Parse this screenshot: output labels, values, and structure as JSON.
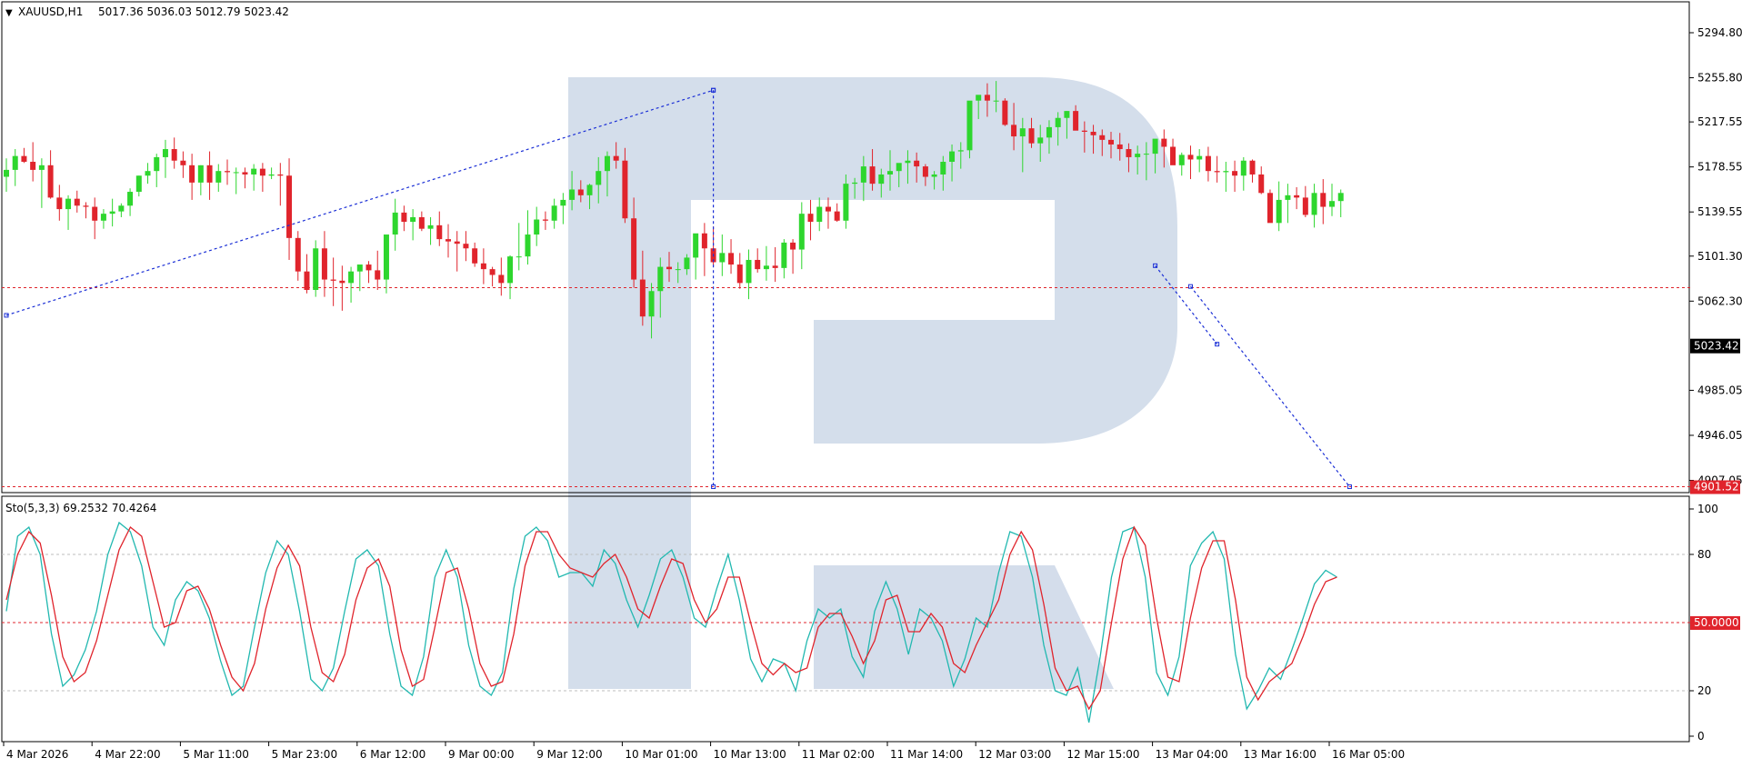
{
  "chart_data": {
    "type": "candlestick",
    "symbol_header": "XAUUSD,H1",
    "ohlc_header": "5017.36 5036.03 5012.79 5023.42",
    "price_axis": {
      "range": [
        4898.0,
        5320.0
      ],
      "ticks": [
        "5294.80",
        "5255.80",
        "5217.55",
        "5178.55",
        "5139.55",
        "5101.30",
        "5062.30",
        "5023.42",
        "4985.05",
        "4946.05",
        "4907.05"
      ],
      "tick_values": [
        5294.8,
        5255.8,
        5217.55,
        5178.55,
        5139.55,
        5101.3,
        5062.3,
        5023.42,
        4985.05,
        4946.05,
        4907.05
      ]
    },
    "current_price": {
      "label": "5023.42",
      "value": 5023.42,
      "color": "#000000"
    },
    "level_lines": [
      {
        "value": 5074.0,
        "color": "#e0242c"
      },
      {
        "value": 4901.52,
        "label": "4901.52",
        "color": "#e0242c"
      }
    ],
    "forecast_lines": [
      {
        "points": [
          [
            0,
            5050
          ],
          [
            80,
            5245
          ]
        ],
        "color": "#1b2fd6"
      },
      {
        "points": [
          [
            80,
            5245
          ],
          [
            80,
            4901.52
          ]
        ],
        "color": "#1b2fd6"
      },
      {
        "points": [
          [
            134,
            5075
          ],
          [
            152,
            4901.52
          ]
        ],
        "color": "#1b2fd6"
      },
      {
        "points": [
          [
            130,
            5093
          ],
          [
            137,
            5025
          ]
        ],
        "color": "#1b2fd6"
      }
    ],
    "candle_count": 152,
    "candles": {
      "o": [
        5170,
        5176,
        5188,
        5183,
        5176,
        5180,
        5152,
        5142,
        5151,
        5145,
        5144,
        5132,
        5138,
        5140,
        5145,
        5157,
        5171,
        5175,
        5187,
        5194,
        5184,
        5180,
        5165,
        5180,
        5165,
        5175,
        5174,
        5174,
        5172,
        5177,
        5171,
        5172,
        5171,
        5117,
        5088,
        5072,
        5108,
        5081,
        5080,
        5078,
        5088,
        5094,
        5089,
        5081,
        5120,
        5139,
        5131,
        5135,
        5125,
        5128,
        5116,
        5114,
        5112,
        5108,
        5095,
        5090,
        5085,
        5078,
        5101,
        5101,
        5120,
        5133,
        5132,
        5145,
        5150,
        5159,
        5154,
        5163,
        5175,
        5188,
        5184,
        5134,
        5081,
        5049,
        5071,
        5092,
        5090,
        5090,
        5100,
        5121,
        5108,
        5096,
        5104,
        5094,
        5078,
        5098,
        5090,
        5093,
        5091,
        5113,
        5107,
        5138,
        5131,
        5144,
        5140,
        5132,
        5164,
        5165,
        5179,
        5164,
        5172,
        5175,
        5182,
        5184,
        5179,
        5170,
        5172,
        5183,
        5192,
        5193,
        5236,
        5241,
        5236,
        5236,
        5215,
        5205,
        5212,
        5199,
        5204,
        5213,
        5221,
        5227,
        5210,
        5209,
        5206,
        5202,
        5198,
        5194,
        5187,
        5190,
        5190,
        5203,
        5196,
        5180,
        5189,
        5185,
        5188,
        5175,
        5174,
        5175,
        5171,
        5184,
        5172,
        5156,
        5130,
        5150,
        5154,
        5152,
        5137,
        5156,
        5144,
        5149
      ],
      "h": [
        5186,
        5194,
        5195,
        5200,
        5186,
        5193,
        5163,
        5154,
        5158,
        5148,
        5152,
        5142,
        5151,
        5147,
        5160,
        5171,
        5182,
        5190,
        5202,
        5204,
        5192,
        5190,
        5180,
        5192,
        5181,
        5185,
        5178,
        5178,
        5181,
        5182,
        5178,
        5182,
        5186,
        5123,
        5103,
        5115,
        5123,
        5100,
        5093,
        5092,
        5091,
        5097,
        5106,
        5117,
        5151,
        5145,
        5142,
        5140,
        5135,
        5140,
        5129,
        5123,
        5123,
        5113,
        5108,
        5092,
        5100,
        5102,
        5130,
        5141,
        5144,
        5140,
        5151,
        5156,
        5175,
        5167,
        5164,
        5187,
        5192,
        5200,
        5195,
        5152,
        5106,
        5078,
        5100,
        5105,
        5096,
        5103,
        5102,
        5130,
        5127,
        5120,
        5116,
        5104,
        5107,
        5108,
        5110,
        5109,
        5116,
        5116,
        5148,
        5150,
        5152,
        5152,
        5147,
        5172,
        5169,
        5188,
        5194,
        5177,
        5193,
        5178,
        5193,
        5191,
        5181,
        5175,
        5188,
        5198,
        5200,
        5214,
        5240,
        5251,
        5253,
        5238,
        5234,
        5221,
        5221,
        5215,
        5219,
        5226,
        5227,
        5232,
        5218,
        5215,
        5211,
        5209,
        5208,
        5199,
        5197,
        5200,
        5198,
        5211,
        5203,
        5191,
        5197,
        5194,
        5196,
        5188,
        5183,
        5184,
        5187,
        5185,
        5179,
        5159,
        5166,
        5164,
        5161,
        5162,
        5164,
        5168,
        5164,
        5159
      ],
      "l": [
        5157,
        5162,
        5182,
        5166,
        5143,
        5151,
        5132,
        5124,
        5139,
        5134,
        5116,
        5125,
        5127,
        5135,
        5136,
        5153,
        5164,
        5161,
        5169,
        5177,
        5169,
        5150,
        5154,
        5150,
        5157,
        5163,
        5155,
        5160,
        5158,
        5157,
        5168,
        5145,
        5098,
        5080,
        5069,
        5066,
        5066,
        5058,
        5054,
        5061,
        5071,
        5078,
        5072,
        5069,
        5106,
        5123,
        5115,
        5123,
        5111,
        5110,
        5100,
        5088,
        5097,
        5092,
        5077,
        5075,
        5067,
        5064,
        5089,
        5094,
        5110,
        5124,
        5125,
        5129,
        5141,
        5148,
        5142,
        5147,
        5153,
        5177,
        5130,
        5074,
        5041,
        5030,
        5048,
        5079,
        5078,
        5085,
        5081,
        5084,
        5093,
        5084,
        5086,
        5073,
        5064,
        5087,
        5080,
        5079,
        5082,
        5086,
        5090,
        5115,
        5123,
        5125,
        5131,
        5125,
        5151,
        5149,
        5158,
        5152,
        5158,
        5161,
        5164,
        5165,
        5162,
        5159,
        5158,
        5166,
        5177,
        5186,
        5220,
        5222,
        5226,
        5214,
        5193,
        5174,
        5195,
        5183,
        5190,
        5197,
        5203,
        5213,
        5191,
        5190,
        5188,
        5186,
        5184,
        5174,
        5172,
        5167,
        5173,
        5178,
        5183,
        5171,
        5168,
        5174,
        5166,
        5165,
        5157,
        5157,
        5158,
        5165,
        5155,
        5139,
        5123,
        5130,
        5142,
        5135,
        5126,
        5129,
        5136,
        5135
      ],
      "c": [
        5176,
        5188,
        5183,
        5176,
        5180,
        5152,
        5142,
        5151,
        5145,
        5144,
        5132,
        5138,
        5140,
        5145,
        5157,
        5171,
        5175,
        5187,
        5194,
        5184,
        5180,
        5165,
        5180,
        5165,
        5175,
        5174,
        5174,
        5172,
        5177,
        5171,
        5172,
        5171,
        5117,
        5088,
        5072,
        5108,
        5081,
        5080,
        5078,
        5088,
        5094,
        5089,
        5081,
        5120,
        5139,
        5131,
        5135,
        5125,
        5128,
        5116,
        5114,
        5112,
        5108,
        5095,
        5090,
        5085,
        5078,
        5101,
        5101,
        5120,
        5133,
        5132,
        5145,
        5150,
        5159,
        5154,
        5163,
        5175,
        5188,
        5184,
        5134,
        5081,
        5049,
        5071,
        5092,
        5090,
        5090,
        5100,
        5121,
        5108,
        5096,
        5104,
        5094,
        5078,
        5098,
        5090,
        5093,
        5091,
        5113,
        5107,
        5138,
        5131,
        5144,
        5140,
        5132,
        5164,
        5165,
        5179,
        5164,
        5172,
        5175,
        5182,
        5184,
        5179,
        5170,
        5172,
        5183,
        5192,
        5193,
        5236,
        5241,
        5236,
        5236,
        5215,
        5205,
        5212,
        5199,
        5204,
        5213,
        5221,
        5227,
        5210,
        5209,
        5206,
        5202,
        5198,
        5194,
        5187,
        5190,
        5190,
        5203,
        5196,
        5180,
        5189,
        5185,
        5188,
        5175,
        5174,
        5175,
        5171,
        5184,
        5172,
        5156,
        5130,
        5150,
        5154,
        5152,
        5137,
        5156,
        5144,
        5149,
        5156
      ]
    },
    "oscillator": {
      "header": "Sto(5,3,3) 69.2532 70.4264",
      "range": [
        0,
        100
      ],
      "ticks": [
        "100",
        "80",
        "20",
        "0"
      ],
      "tick_values": [
        100,
        80,
        20,
        0
      ],
      "level_lines": [
        {
          "value": 80,
          "color": "#bdbdbd"
        },
        {
          "value": 50,
          "label": "50.0000",
          "color": "#e0242c"
        },
        {
          "value": 20,
          "color": "#bdbdbd"
        }
      ],
      "series": [
        {
          "color": "#21b8b0",
          "values": [
            55,
            88,
            92,
            80,
            45,
            22,
            27,
            38,
            55,
            80,
            94,
            90,
            75,
            48,
            40,
            60,
            68,
            64,
            52,
            33,
            18,
            22,
            48,
            72,
            86,
            80,
            55,
            25,
            20,
            30,
            55,
            78,
            82,
            75,
            45,
            22,
            18,
            35,
            70,
            82,
            70,
            40,
            22,
            18,
            28,
            65,
            88,
            92,
            86,
            70,
            72,
            72,
            66,
            82,
            76,
            60,
            48,
            62,
            78,
            82,
            70,
            52,
            48,
            65,
            80,
            60,
            34,
            24,
            34,
            32,
            20,
            42,
            56,
            52,
            56,
            35,
            26,
            55,
            68,
            56,
            36,
            56,
            52,
            42,
            22,
            34,
            52,
            48,
            72,
            90,
            88,
            70,
            40,
            20,
            18,
            30,
            6,
            35,
            70,
            90,
            92,
            70,
            28,
            18,
            35,
            75,
            85,
            90,
            78,
            36,
            12,
            20,
            30,
            25,
            38,
            52,
            67,
            73,
            70
          ],
          "x_start": 0,
          "x_step": 1.276
        },
        {
          "color": "#e0242c",
          "values": [
            60,
            80,
            90,
            85,
            62,
            35,
            24,
            28,
            42,
            62,
            82,
            92,
            88,
            68,
            48,
            50,
            64,
            66,
            56,
            40,
            26,
            20,
            32,
            56,
            74,
            84,
            75,
            48,
            28,
            24,
            36,
            60,
            74,
            78,
            66,
            38,
            22,
            25,
            48,
            72,
            74,
            56,
            32,
            22,
            24,
            45,
            75,
            90,
            90,
            80,
            74,
            72,
            70,
            76,
            80,
            70,
            56,
            52,
            66,
            78,
            76,
            60,
            50,
            56,
            70,
            70,
            50,
            32,
            27,
            32,
            28,
            30,
            48,
            54,
            54,
            44,
            32,
            42,
            60,
            62,
            46,
            46,
            54,
            48,
            32,
            28,
            40,
            50,
            60,
            80,
            90,
            82,
            58,
            30,
            20,
            22,
            12,
            20,
            50,
            78,
            92,
            84,
            52,
            26,
            24,
            52,
            74,
            86,
            86,
            60,
            26,
            16,
            24,
            28,
            32,
            44,
            58,
            68,
            70
          ],
          "x_start": 0,
          "x_step": 1.276
        }
      ]
    },
    "time_axis": {
      "labels": [
        "4 Mar 2026",
        "4 Mar 22:00",
        "5 Mar 11:00",
        "5 Mar 23:00",
        "6 Mar 12:00",
        "9 Mar 00:00",
        "9 Mar 12:00",
        "10 Mar 01:00",
        "10 Mar 13:00",
        "11 Mar 02:00",
        "11 Mar 14:00",
        "12 Mar 03:00",
        "12 Mar 15:00",
        "13 Mar 04:00",
        "13 Mar 16:00",
        "16 Mar 05:00"
      ],
      "label_index": [
        0,
        10,
        20,
        30,
        40,
        50,
        60,
        70,
        80,
        90,
        100,
        110,
        120,
        130,
        140,
        150
      ]
    },
    "colors": {
      "bull": "#2ed62e",
      "bear": "#e0242c",
      "grid": "#bdbdbd",
      "axis_text": "#000000",
      "watermark": "#cdd8e8"
    }
  }
}
